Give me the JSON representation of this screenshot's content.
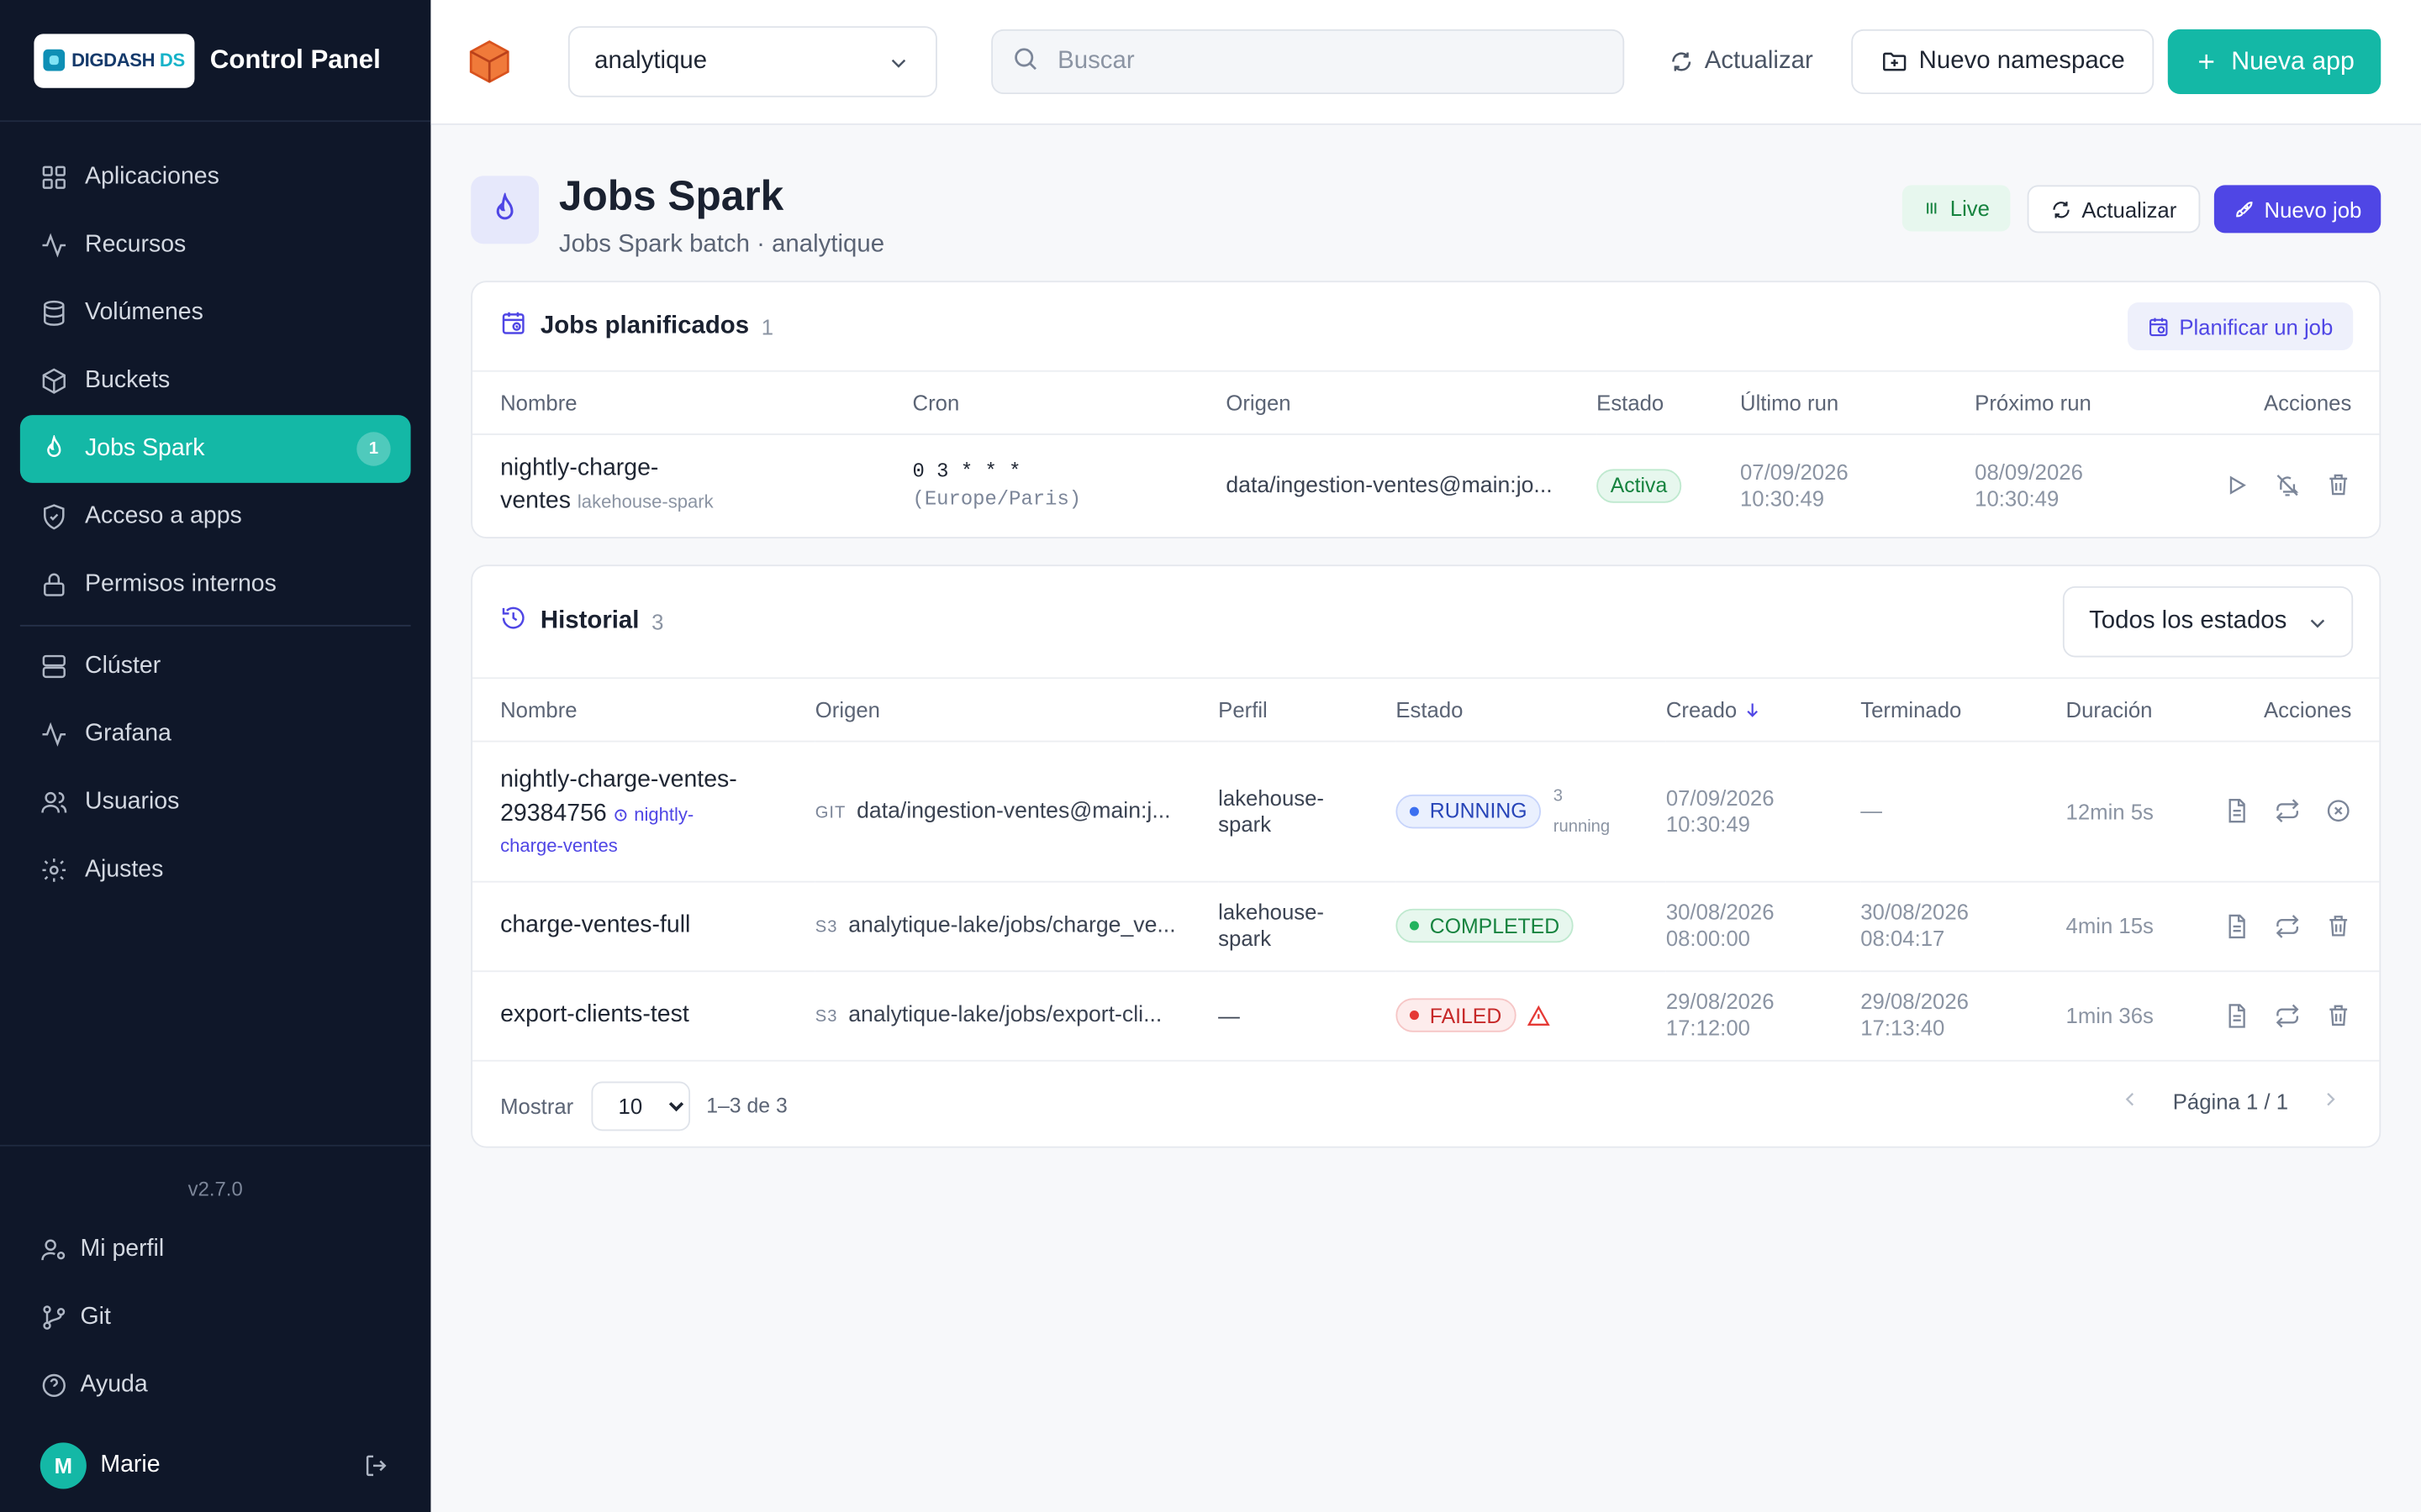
{
  "brand": {
    "logo_text_a": "DIGDASH",
    "logo_text_b": "DS",
    "title": "Control Panel"
  },
  "sidebar": {
    "items": [
      {
        "label": "Aplicaciones",
        "icon": "grid-icon"
      },
      {
        "label": "Recursos",
        "icon": "activity-icon"
      },
      {
        "label": "Volúmenes",
        "icon": "database-icon"
      },
      {
        "label": "Buckets",
        "icon": "box-icon"
      },
      {
        "label": "Jobs Spark",
        "icon": "flame-icon",
        "badge": "1",
        "active": true
      },
      {
        "label": "Acceso a apps",
        "icon": "shield-icon"
      },
      {
        "label": "Permisos internos",
        "icon": "lock-icon"
      }
    ],
    "items2": [
      {
        "label": "Clúster",
        "icon": "server-icon"
      },
      {
        "label": "Grafana",
        "icon": "activity-icon"
      },
      {
        "label": "Usuarios",
        "icon": "users-icon"
      },
      {
        "label": "Ajustes",
        "icon": "gear-icon"
      }
    ],
    "version": "v2.7.0",
    "bottom": [
      {
        "label": "Mi perfil",
        "icon": "user-cog-icon"
      },
      {
        "label": "Git",
        "icon": "git-branch-icon"
      },
      {
        "label": "Ayuda",
        "icon": "help-circle-icon"
      }
    ],
    "user": {
      "initial": "M",
      "name": "Marie"
    }
  },
  "topbar": {
    "namespace": "analytique",
    "search_placeholder": "Buscar",
    "refresh_label": "Actualizar",
    "new_namespace_label": "Nuevo namespace",
    "new_app_label": "Nueva app"
  },
  "page": {
    "title": "Jobs Spark",
    "subtitle": "Jobs Spark batch · analytique",
    "live_label": "Live",
    "refresh_label": "Actualizar",
    "new_job_label": "Nuevo job"
  },
  "scheduled": {
    "title": "Jobs planificados",
    "count": "1",
    "plan_button": "Planificar un job",
    "columns": [
      "Nombre",
      "Cron",
      "Origen",
      "Estado",
      "Último run",
      "Próximo run",
      "Acciones"
    ],
    "rows": [
      {
        "name_a": "nightly-charge-",
        "name_b": "ventes",
        "profile": "lakehouse-spark",
        "cron": "0 3 * * *",
        "tz": "(Europe/Paris)",
        "origin": "data/ingestion-ventes@main:jo...",
        "status": "Activa",
        "last_date": "07/09/2026",
        "last_time": "10:30:49",
        "next_date": "08/09/2026",
        "next_time": "10:30:49"
      }
    ]
  },
  "history": {
    "title": "Historial",
    "count": "3",
    "filter": "Todos los estados",
    "columns": [
      "Nombre",
      "Origen",
      "Perfil",
      "Estado",
      "Creado",
      "Terminado",
      "Duración",
      "Acciones"
    ],
    "rows": [
      {
        "name_a": "nightly-charge-ventes-",
        "name_b": "29384756",
        "sched_a": "nightly-",
        "sched_b": "charge-ventes",
        "src_type": "GIT",
        "origin": "data/ingestion-ventes@main:j...",
        "profile_a": "lakehouse-",
        "profile_b": "spark",
        "status": "RUNNING",
        "extra_a": "3",
        "extra_b": "running",
        "created_date": "07/09/2026",
        "created_time": "10:30:49",
        "finished": "—",
        "duration": "12min 5s"
      },
      {
        "name": "charge-ventes-full",
        "src_type": "S3",
        "origin": "analytique-lake/jobs/charge_ve...",
        "profile_a": "lakehouse-",
        "profile_b": "spark",
        "status": "COMPLETED",
        "created_date": "30/08/2026",
        "created_time": "08:00:00",
        "finished_date": "30/08/2026",
        "finished_time": "08:04:17",
        "duration": "4min 15s"
      },
      {
        "name": "export-clients-test",
        "src_type": "S3",
        "origin": "analytique-lake/jobs/export-cli...",
        "profile": "—",
        "status": "FAILED",
        "created_date": "29/08/2026",
        "created_time": "17:12:00",
        "finished_date": "29/08/2026",
        "finished_time": "17:13:40",
        "duration": "1min 36s"
      }
    ],
    "pager": {
      "show_label": "Mostrar",
      "page_size": "10",
      "range": "1–3 de 3",
      "page_label": "Página 1 / 1"
    }
  },
  "colors": {
    "accent_teal": "#14b8a6",
    "accent_indigo": "#4f46e5",
    "sidebar_bg": "#0f1729"
  }
}
